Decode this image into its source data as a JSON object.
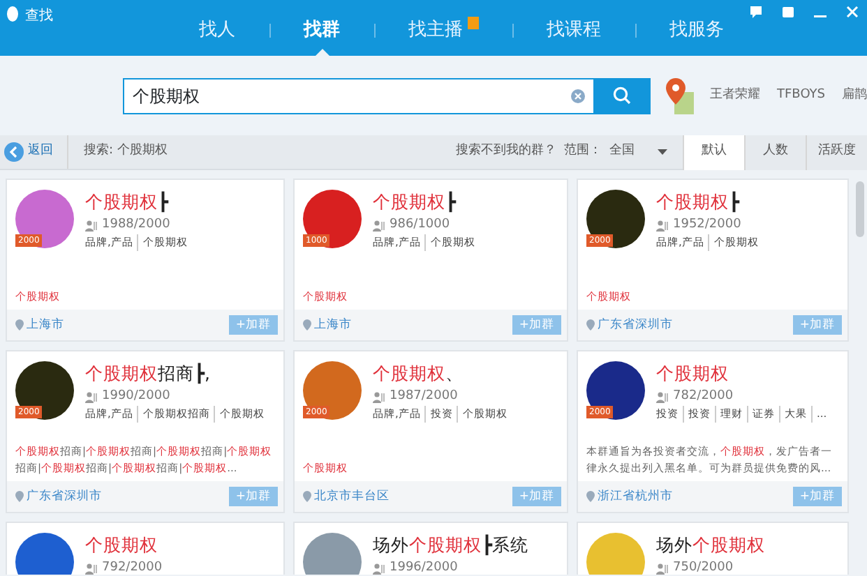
{
  "window": {
    "title": "查找"
  },
  "nav_tabs": [
    {
      "label": "找人",
      "selected": false,
      "hot": false
    },
    {
      "label": "找群",
      "selected": true,
      "hot": false
    },
    {
      "label": "找主播",
      "selected": false,
      "hot": true
    },
    {
      "label": "找课程",
      "selected": false,
      "hot": false
    },
    {
      "label": "找服务",
      "selected": false,
      "hot": false
    }
  ],
  "search": {
    "value": "个股期权"
  },
  "hot_searches": [
    "王者荣耀",
    "TFBOYS",
    "扁鹊"
  ],
  "filter_bar": {
    "back": "返回",
    "query": "搜索: 个股期权",
    "help": "搜索不到我的群？",
    "scope_label": "范围：",
    "scope_value": "全国"
  },
  "sort_tabs": [
    {
      "label": "默认",
      "selected": true
    },
    {
      "label": "人数",
      "selected": false
    },
    {
      "label": "活跃度",
      "selected": false
    }
  ],
  "groups": [
    {
      "color": "#c86ad0",
      "level_badge": "2000",
      "title": [
        {
          "text": "个股期权",
          "highlight": true
        },
        {
          "text": "┣",
          "highlight": false
        }
      ],
      "members": "1988/2000",
      "tags": [
        "品牌,产品",
        "个股期权"
      ],
      "description": [
        {
          "text": "个股期权",
          "highlight": true
        }
      ],
      "location": "上海市",
      "join": "+加群"
    },
    {
      "color": "#d82020",
      "level_badge": "1000",
      "title": [
        {
          "text": "个股期权",
          "highlight": true
        },
        {
          "text": "┣",
          "highlight": false
        }
      ],
      "members": "986/1000",
      "tags": [
        "品牌,产品",
        "个股期权"
      ],
      "description": [
        {
          "text": "个股期权",
          "highlight": true
        }
      ],
      "location": "上海市",
      "join": "+加群"
    },
    {
      "color": "#2a2a10",
      "level_badge": "2000",
      "title": [
        {
          "text": "个股期权",
          "highlight": true
        },
        {
          "text": "┣",
          "highlight": false
        }
      ],
      "members": "1952/2000",
      "tags": [
        "品牌,产品",
        "个股期权"
      ],
      "description": [
        {
          "text": "个股期权",
          "highlight": true
        }
      ],
      "location": "广东省深圳市",
      "join": "+加群"
    },
    {
      "color": "#2a2a10",
      "level_badge": "2000",
      "title": [
        {
          "text": "个股期权",
          "highlight": true
        },
        {
          "text": "招商┣,",
          "highlight": false
        }
      ],
      "members": "1990/2000",
      "tags": [
        "品牌,产品",
        "个股期权招商",
        "个股期权"
      ],
      "description": [
        {
          "text": "个股期权",
          "highlight": true
        },
        {
          "text": "招商|",
          "highlight": false
        },
        {
          "text": "个股期权",
          "highlight": true
        },
        {
          "text": "招商|",
          "highlight": false
        },
        {
          "text": "个股期权",
          "highlight": true
        },
        {
          "text": "招商|",
          "highlight": false
        },
        {
          "text": "个股期权",
          "highlight": true
        },
        {
          "text": "招商|",
          "highlight": false
        },
        {
          "text": "个股期权",
          "highlight": true
        },
        {
          "text": "招商|",
          "highlight": false
        },
        {
          "text": "个股期权",
          "highlight": true
        },
        {
          "text": "招商|",
          "highlight": false
        },
        {
          "text": "个股期权",
          "highlight": true
        },
        {
          "text": "...",
          "highlight": false
        }
      ],
      "location": "广东省深圳市",
      "join": "+加群"
    },
    {
      "color": "#d2691e",
      "level_badge": "2000",
      "title": [
        {
          "text": "个股期权",
          "highlight": true
        },
        {
          "text": "、",
          "highlight": false
        }
      ],
      "members": "1987/2000",
      "tags": [
        "品牌,产品",
        "投资",
        "个股期权"
      ],
      "description": [
        {
          "text": "个股期权",
          "highlight": true
        }
      ],
      "location": "北京市丰台区",
      "join": "+加群"
    },
    {
      "color": "#1a2a8a",
      "level_badge": "2000",
      "title": [
        {
          "text": "个股期权",
          "highlight": true
        }
      ],
      "members": "782/2000",
      "tags": [
        "投资",
        "投资",
        "理财",
        "证券",
        "大果",
        "..."
      ],
      "description": [
        {
          "text": "本群通旨为各投资者交流，",
          "highlight": false
        },
        {
          "text": "个股期权",
          "highlight": true
        },
        {
          "text": "，发广告者一律永久提出列入黑名单。可为群员提供免费的风...",
          "highlight": false
        }
      ],
      "location": "浙江省杭州市",
      "join": "+加群"
    },
    {
      "color": "#1e5fd0",
      "title": [
        {
          "text": "个股期权",
          "highlight": true
        }
      ],
      "members": "792/2000"
    },
    {
      "color": "#8a9aa8",
      "title": [
        {
          "text": "场外",
          "highlight": false
        },
        {
          "text": "个股期权",
          "highlight": true
        },
        {
          "text": "┣系统",
          "highlight": false
        }
      ],
      "members": "1996/2000"
    },
    {
      "color": "#e8c030",
      "title": [
        {
          "text": "场外",
          "highlight": false
        },
        {
          "text": "个股期权",
          "highlight": true
        }
      ],
      "members": "750/2000"
    }
  ]
}
